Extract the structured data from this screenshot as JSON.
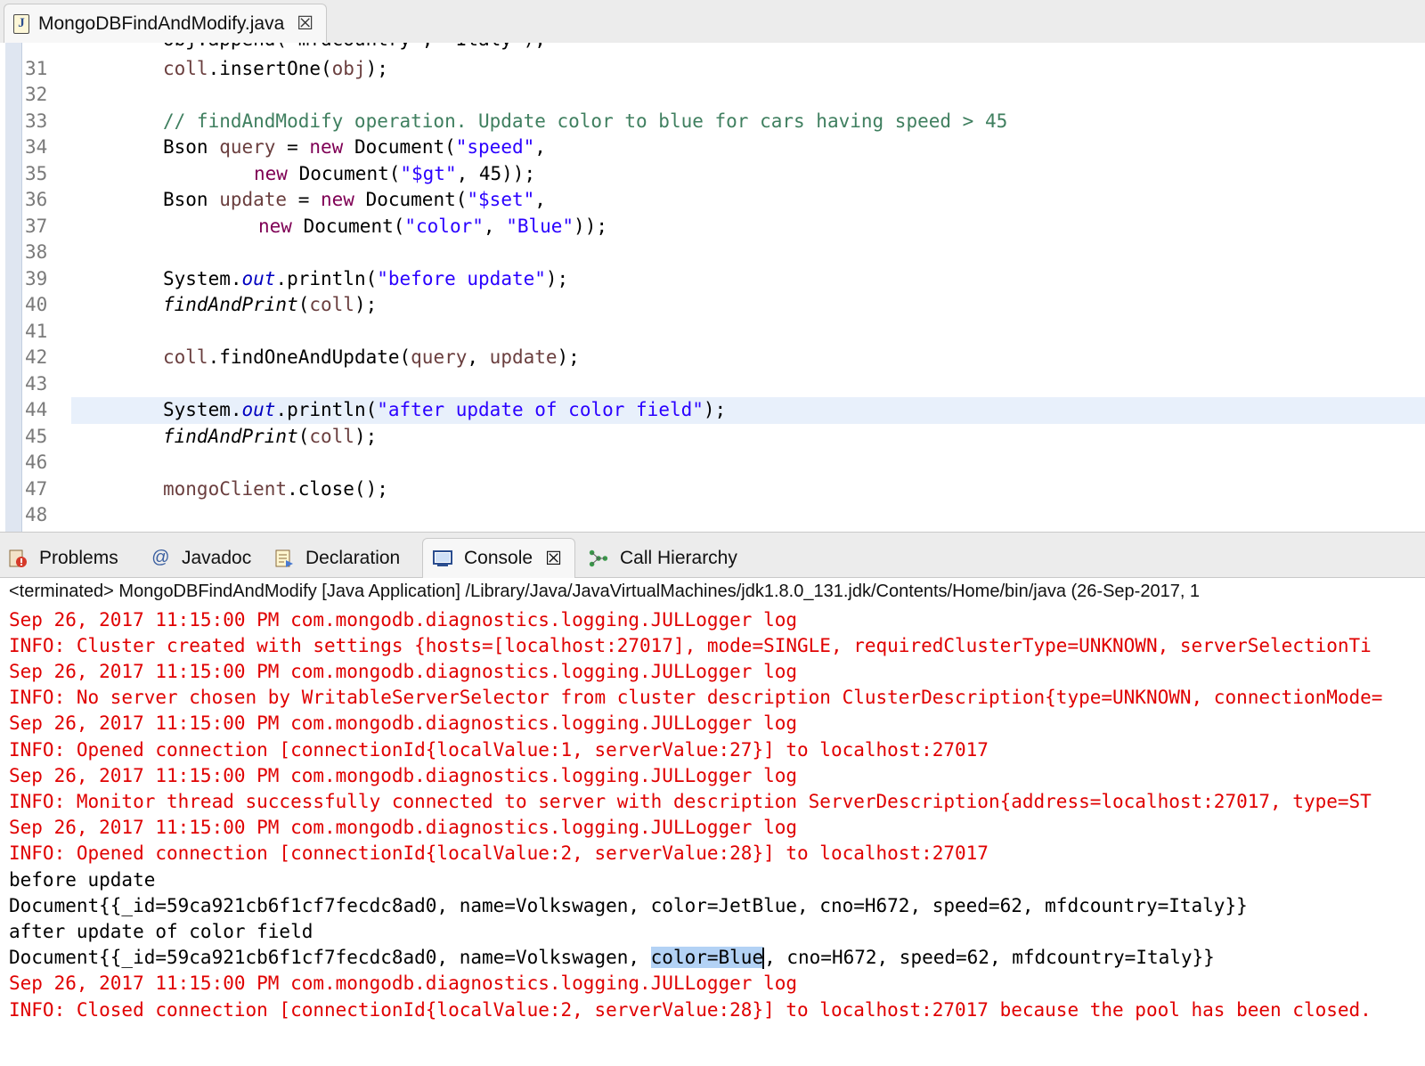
{
  "editor": {
    "tab_title": "MongoDBFindAndModify.java",
    "tab_close": "☒",
    "cut_line_text": "obj.append(\"mfdcountry\", \"Italy\");",
    "lines": [
      {
        "num": "31"
      },
      {
        "num": "32"
      },
      {
        "num": "33"
      },
      {
        "num": "34"
      },
      {
        "num": "35"
      },
      {
        "num": "36"
      },
      {
        "num": "37"
      },
      {
        "num": "38"
      },
      {
        "num": "39"
      },
      {
        "num": "40"
      },
      {
        "num": "41"
      },
      {
        "num": "42"
      },
      {
        "num": "43"
      },
      {
        "num": "44"
      },
      {
        "num": "45"
      },
      {
        "num": "46"
      },
      {
        "num": "47"
      },
      {
        "num": "48"
      }
    ],
    "code": {
      "l31": {
        "a": "coll",
        "b": ".insertOne(",
        "c": "obj",
        "d": ");"
      },
      "l33": {
        "comment": "// findAndModify operation. Update color to blue for cars having speed > 45"
      },
      "l34": {
        "a": "Bson ",
        "b": "query",
        "c": " = ",
        "kw": "new",
        "d": " Document(",
        "s": "\"speed\"",
        "e": ","
      },
      "l35": {
        "kw": "new",
        "d": " Document(",
        "s": "\"$gt\"",
        "e": ", 45));"
      },
      "l36": {
        "a": "Bson ",
        "b": "update",
        "c": " = ",
        "kw": "new",
        "d": " Document(",
        "s": "\"$set\"",
        "e": ","
      },
      "l37": {
        "kw": "new",
        "d": " Document(",
        "s1": "\"color\"",
        "m": ", ",
        "s2": "\"Blue\"",
        "e": "));"
      },
      "l39": {
        "a": "System.",
        "f": "out",
        "b": ".println(",
        "s": "\"before update\"",
        "e": ");"
      },
      "l40": {
        "i": "findAndPrint",
        "b": "(",
        "v": "coll",
        "e": ");"
      },
      "l42": {
        "v1": "coll",
        "b": ".findOneAndUpdate(",
        "v2": "query",
        "m": ", ",
        "v3": "update",
        "e": ");"
      },
      "l44": {
        "a": "System.",
        "f": "out",
        "b": ".println(",
        "s": "\"after update of color field\"",
        "e": ");"
      },
      "l45": {
        "i": "findAndPrint",
        "b": "(",
        "v": "coll",
        "e": ");"
      },
      "l47": {
        "v": "mongoClient",
        "b": ".close();"
      }
    }
  },
  "panel": {
    "tabs": {
      "problems": "Problems",
      "javadoc": "Javadoc",
      "declaration": "Declaration",
      "console": "Console",
      "call_hierarchy": "Call Hierarchy"
    },
    "console_close": "☒"
  },
  "console": {
    "header": "<terminated> MongoDBFindAndModify [Java Application] /Library/Java/JavaVirtualMachines/jdk1.8.0_131.jdk/Contents/Home/bin/java (26-Sep-2017, 1",
    "lines": [
      {
        "type": "err",
        "text": "Sep 26, 2017 11:15:00 PM com.mongodb.diagnostics.logging.JULLogger log"
      },
      {
        "type": "err",
        "text": "INFO: Cluster created with settings {hosts=[localhost:27017], mode=SINGLE, requiredClusterType=UNKNOWN, serverSelectionTi"
      },
      {
        "type": "err",
        "text": "Sep 26, 2017 11:15:00 PM com.mongodb.diagnostics.logging.JULLogger log"
      },
      {
        "type": "err",
        "text": "INFO: No server chosen by WritableServerSelector from cluster description ClusterDescription{type=UNKNOWN, connectionMode="
      },
      {
        "type": "err",
        "text": "Sep 26, 2017 11:15:00 PM com.mongodb.diagnostics.logging.JULLogger log"
      },
      {
        "type": "err",
        "text": "INFO: Opened connection [connectionId{localValue:1, serverValue:27}] to localhost:27017"
      },
      {
        "type": "err",
        "text": "Sep 26, 2017 11:15:00 PM com.mongodb.diagnostics.logging.JULLogger log"
      },
      {
        "type": "err",
        "text": "INFO: Monitor thread successfully connected to server with description ServerDescription{address=localhost:27017, type=ST"
      },
      {
        "type": "err",
        "text": "Sep 26, 2017 11:15:00 PM com.mongodb.diagnostics.logging.JULLogger log"
      },
      {
        "type": "err",
        "text": "INFO: Opened connection [connectionId{localValue:2, serverValue:28}] to localhost:27017"
      },
      {
        "type": "out",
        "text": "before update"
      },
      {
        "type": "out",
        "text": "Document{{_id=59ca921cb6f1cf7fecdc8ad0, name=Volkswagen, color=JetBlue, cno=H672, speed=62, mfdcountry=Italy}}"
      },
      {
        "type": "out",
        "text": "after update of color field"
      },
      {
        "type": "out-sel",
        "pre": "Document{{_id=59ca921cb6f1cf7fecdc8ad0, name=Volkswagen, ",
        "sel": "color=Blue",
        "post": ", cno=H672, speed=62, mfdcountry=Italy}}"
      },
      {
        "type": "err",
        "text": "Sep 26, 2017 11:15:00 PM com.mongodb.diagnostics.logging.JULLogger log"
      },
      {
        "type": "err",
        "text": "INFO: Closed connection [connectionId{localValue:2, serverValue:28}] to localhost:27017 because the pool has been closed."
      }
    ]
  },
  "colors": {
    "keyword": "#7f0055",
    "string": "#2a00ff",
    "comment": "#3f7f5f",
    "field": "#0000c0",
    "console_error": "#e00000",
    "selection": "#b3d2f5"
  }
}
